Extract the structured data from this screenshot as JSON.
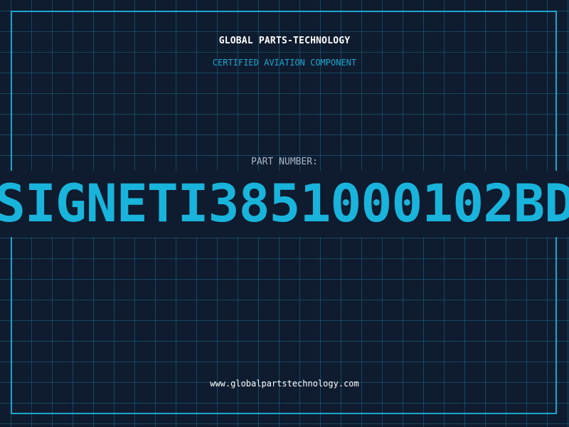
{
  "header": {
    "company_name": "GLOBAL PARTS-TECHNOLOGY",
    "certification": "CERTIFIED AVIATION COMPONENT"
  },
  "part": {
    "label": "PART NUMBER:",
    "number": "SIGNETI3851000102BD"
  },
  "footer": {
    "website": "www.globalpartstechnology.com"
  },
  "colors": {
    "background": "#0f1b2e",
    "grid": "#186e8c",
    "accent": "#1ea6cf",
    "part_number": "#19b4dc",
    "label": "#a9b8c8",
    "text": "#ffffff"
  }
}
